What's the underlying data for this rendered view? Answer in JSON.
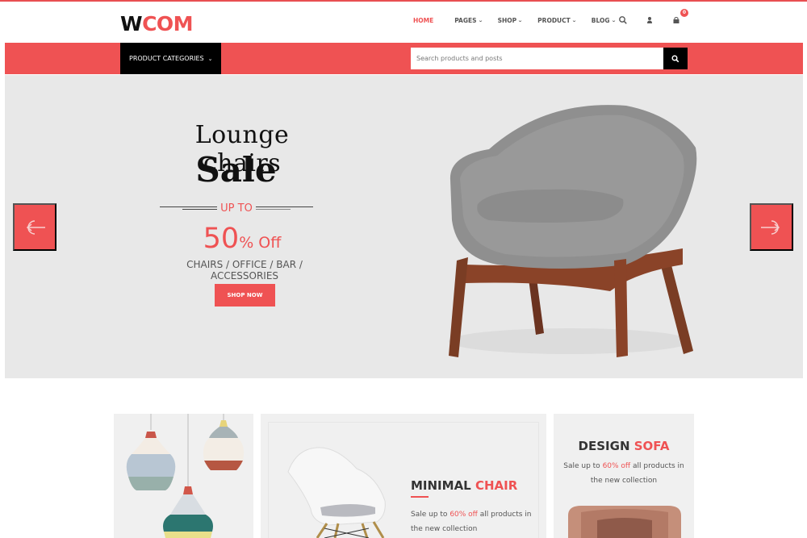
{
  "brand": {
    "logo_part1": "W",
    "logo_part2": "COM",
    "accent_color": "#ef5253"
  },
  "nav": {
    "items": [
      {
        "label": "HOME",
        "active": true,
        "has_dropdown": false
      },
      {
        "label": "PAGES",
        "active": false,
        "has_dropdown": true
      },
      {
        "label": "SHOP",
        "active": false,
        "has_dropdown": true
      },
      {
        "label": "PRODUCT",
        "active": false,
        "has_dropdown": true
      },
      {
        "label": "BLOG",
        "active": false,
        "has_dropdown": true
      }
    ],
    "dropdown_glyph": "⌄",
    "icons": [
      "search-icon",
      "user-icon",
      "cart-icon"
    ],
    "cart_count": "0"
  },
  "toolbar": {
    "categories_label": "PRODUCT CATEGORIES",
    "categories_chevron": "⌄",
    "search_placeholder": "Search products and posts",
    "search_value": ""
  },
  "hero": {
    "title": "Lounge chairs",
    "subtitle": "Sale",
    "upto": "UP TO",
    "discount_number": "50",
    "discount_suffix": "% Off",
    "categories": "CHAIRS / OFFICE / BAR / ACCESSORIES",
    "cta": "SHOP NOW",
    "prev_icon": "arrow-left-circle-icon",
    "next_icon": "arrow-right-circle-icon"
  },
  "banners": [
    {
      "name": "pendant-lamps",
      "image": "pendant-lamps-image"
    },
    {
      "title_part1": "MINIMAL",
      "title_part2": "CHAIR",
      "desc_before": "Sale up to ",
      "desc_accent": "60% off",
      "desc_after": " all products in the new collection"
    },
    {
      "title_part1": "DESIGN",
      "title_part2": "SOFA",
      "desc_before": "Sale up to ",
      "desc_accent": "60% off",
      "desc_after": " all products in the new collection"
    }
  ]
}
